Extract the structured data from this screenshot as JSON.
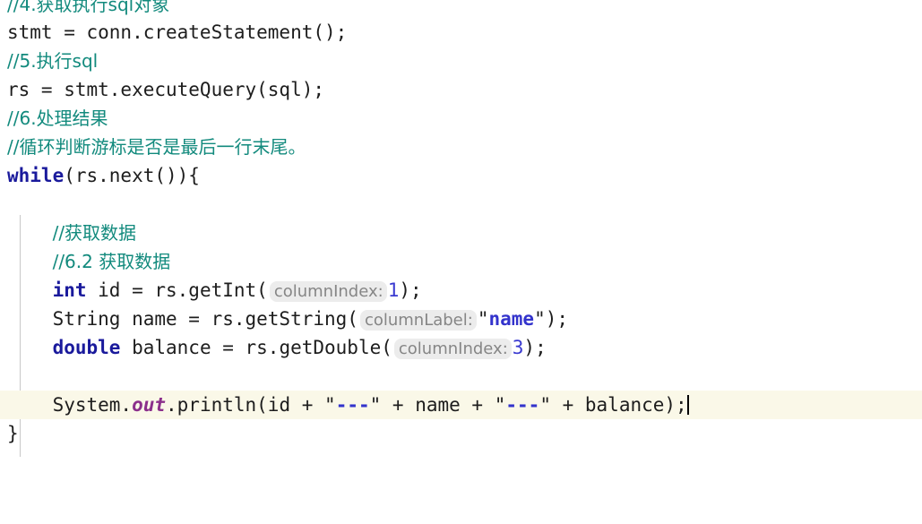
{
  "editor": {
    "language": "Java",
    "theme": "IntelliJ Light",
    "colors": {
      "background": "#ffffff",
      "comment": "#128a7d",
      "keyword": "#1a1a9c",
      "string": "#3333cc",
      "number": "#3a3ad0",
      "static_field": "#8b2f8b",
      "hint_background": "#ececec",
      "hint_text": "#868686",
      "current_line_highlight": "#faf8e8",
      "indent_guide": "#c8c8c8",
      "plain_text": "#1d1d1d"
    },
    "caret_visible": true,
    "indent_guide_visible": true
  },
  "lines": [
    {
      "id": "line-comment-4",
      "clipped": true,
      "tokens": [
        {
          "kind": "comment",
          "text": "//4.获取执行sql对象"
        }
      ]
    },
    {
      "id": "line-create-statement",
      "tokens": [
        {
          "kind": "plain",
          "text": "stmt = conn.createStatement();"
        }
      ]
    },
    {
      "id": "line-comment-5",
      "tokens": [
        {
          "kind": "comment",
          "text": "//5.执行sql"
        }
      ]
    },
    {
      "id": "line-execute-query",
      "tokens": [
        {
          "kind": "plain",
          "text": "rs = stmt.executeQuery(sql);"
        }
      ]
    },
    {
      "id": "line-comment-6",
      "tokens": [
        {
          "kind": "comment",
          "text": "//6.处理结果"
        }
      ]
    },
    {
      "id": "line-comment-loop",
      "tokens": [
        {
          "kind": "comment",
          "text": "//循环判断游标是否是最后一行末尾。"
        }
      ]
    },
    {
      "id": "line-while",
      "tokens": [
        {
          "kind": "keyword",
          "text": "while"
        },
        {
          "kind": "plain",
          "text": "(rs.next()){"
        }
      ]
    },
    {
      "id": "line-blank-1",
      "tokens": []
    },
    {
      "id": "line-comment-fetch",
      "tokens": [
        {
          "kind": "plain",
          "text": "    "
        },
        {
          "kind": "comment",
          "text": "//获取数据"
        }
      ]
    },
    {
      "id": "line-comment-62",
      "tokens": [
        {
          "kind": "plain",
          "text": "    "
        },
        {
          "kind": "comment",
          "text": "//6.2 获取数据"
        }
      ]
    },
    {
      "id": "line-get-int",
      "tokens": [
        {
          "kind": "plain",
          "text": "    "
        },
        {
          "kind": "keyword",
          "text": "int"
        },
        {
          "kind": "plain",
          "text": " id = rs.getInt("
        },
        {
          "kind": "hint",
          "text": "columnIndex:"
        },
        {
          "kind": "number",
          "text": "1"
        },
        {
          "kind": "plain",
          "text": ");"
        }
      ]
    },
    {
      "id": "line-get-string",
      "tokens": [
        {
          "kind": "plain",
          "text": "    String name = rs.getString("
        },
        {
          "kind": "hint",
          "text": "columnLabel:"
        },
        {
          "kind": "quote",
          "text": "\""
        },
        {
          "kind": "string",
          "text": "name"
        },
        {
          "kind": "quote",
          "text": "\""
        },
        {
          "kind": "plain",
          "text": ");"
        }
      ]
    },
    {
      "id": "line-get-double",
      "tokens": [
        {
          "kind": "plain",
          "text": "    "
        },
        {
          "kind": "keyword",
          "text": "double"
        },
        {
          "kind": "plain",
          "text": " balance = rs.getDouble("
        },
        {
          "kind": "hint",
          "text": "columnIndex:"
        },
        {
          "kind": "number",
          "text": "3"
        },
        {
          "kind": "plain",
          "text": ");"
        }
      ]
    },
    {
      "id": "line-blank-2",
      "tokens": []
    },
    {
      "id": "line-println",
      "current": true,
      "caret_at_end": true,
      "tokens": [
        {
          "kind": "plain",
          "text": "    System."
        },
        {
          "kind": "static",
          "text": "out"
        },
        {
          "kind": "plain",
          "text": ".println(id + "
        },
        {
          "kind": "quote",
          "text": "\""
        },
        {
          "kind": "string",
          "text": "---"
        },
        {
          "kind": "quote",
          "text": "\""
        },
        {
          "kind": "plain",
          "text": " + name + "
        },
        {
          "kind": "quote",
          "text": "\""
        },
        {
          "kind": "string",
          "text": "---"
        },
        {
          "kind": "quote",
          "text": "\""
        },
        {
          "kind": "plain",
          "text": " + balance);"
        }
      ]
    },
    {
      "id": "line-close-brace",
      "tokens": [
        {
          "kind": "plain",
          "text": "}"
        }
      ]
    }
  ]
}
